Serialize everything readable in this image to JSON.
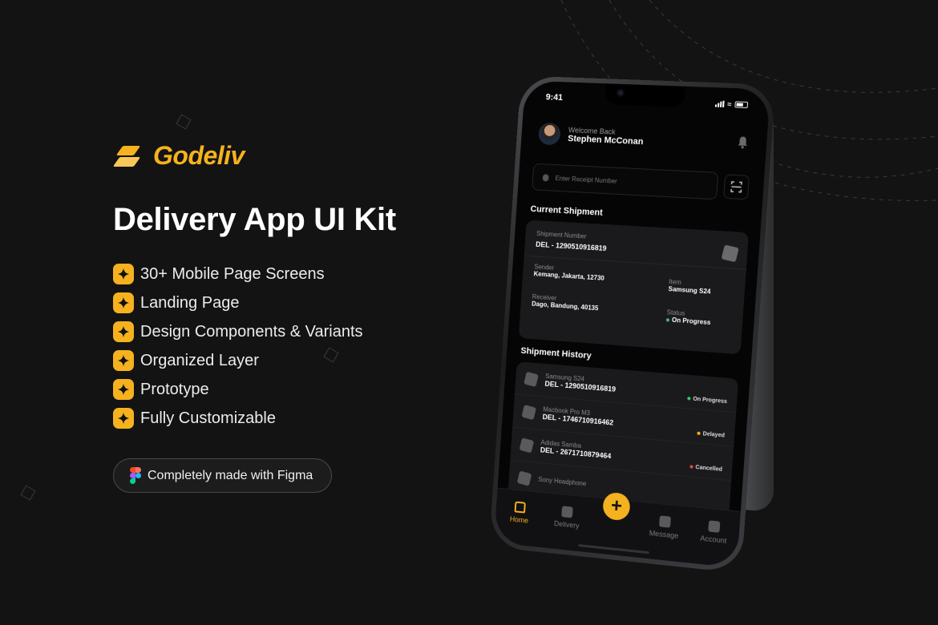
{
  "brand": {
    "name": "Godeliv",
    "accent": "#F5B21E"
  },
  "headline": "Delivery App UI Kit",
  "features": [
    {
      "label": "30+ Mobile Page Screens"
    },
    {
      "label": "Landing Page"
    },
    {
      "label": "Design Components & Variants"
    },
    {
      "label": "Organized Layer"
    },
    {
      "label": "Prototype"
    },
    {
      "label": "Fully Customizable"
    }
  ],
  "figma_pill": {
    "label": "Completely made with Figma",
    "icon": "figma-logo-icon"
  },
  "phone": {
    "status_bar": {
      "time": "9:41"
    },
    "header": {
      "greeting": "Welcome Back",
      "user_name": "Stephen McConan"
    },
    "search": {
      "placeholder": "Enter Receipt Number",
      "value": ""
    },
    "current_shipment": {
      "title": "Current Shipment",
      "number_label": "Shipment Number",
      "number": "DEL - 1290510916819",
      "sender_label": "Sender",
      "sender": "Kemang, Jakarta, 12730",
      "item_label": "Item",
      "item": "Samsung S24",
      "receiver_label": "Receiver",
      "receiver": "Dago, Bandung, 40135",
      "status_label": "Status",
      "status": "On Progress",
      "status_color": "#2ECC71"
    },
    "history": {
      "title": "Shipment History",
      "items": [
        {
          "name": "Samsung S24",
          "number": "DEL - 1290510916819",
          "status": "On Progress",
          "status_color": "#2ECC71"
        },
        {
          "name": "Macbook Pro M3",
          "number": "DEL - 1746710916462",
          "status": "Delayed",
          "status_color": "#F5B21E"
        },
        {
          "name": "Adidas Samba",
          "number": "DEL - 2671710879464",
          "status": "Cancelled",
          "status_color": "#E74C3C"
        },
        {
          "name": "Sony Headphone",
          "number": "",
          "status": "",
          "status_color": ""
        }
      ]
    },
    "tabs": [
      {
        "label": "Home",
        "active": true
      },
      {
        "label": "Delivery",
        "active": false
      },
      {
        "label": "Message",
        "active": false
      },
      {
        "label": "Account",
        "active": false
      }
    ],
    "fab_label": "+"
  }
}
